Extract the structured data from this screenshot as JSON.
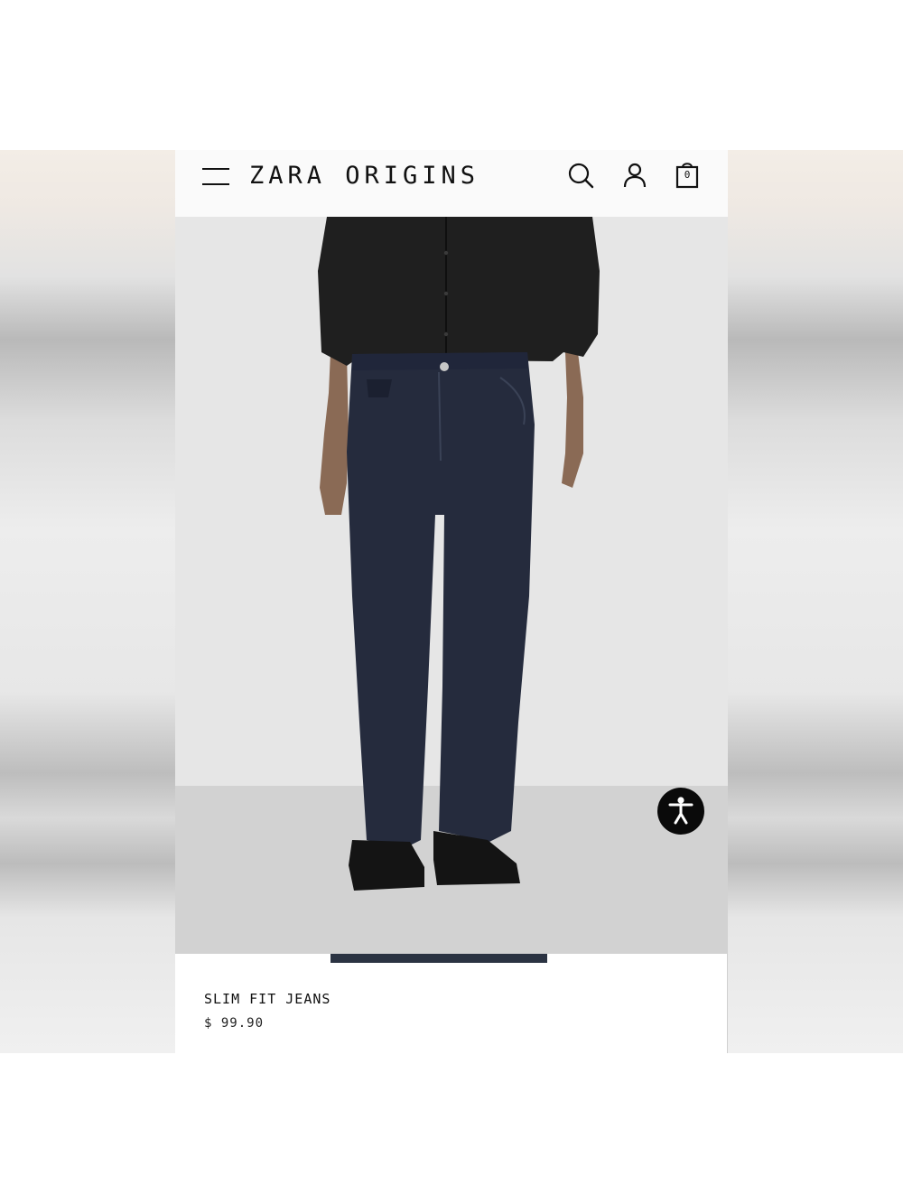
{
  "header": {
    "brand": "ZARA ORIGINS",
    "bag_count": "0",
    "icons": [
      "menu-icon",
      "search-icon",
      "account-icon",
      "bag-icon"
    ]
  },
  "product": {
    "name": "SLIM FIT JEANS",
    "price": "$ 99.90"
  },
  "colors": {
    "accent": "#111111",
    "denim": "#252b3d",
    "shirt": "#1d1d1d",
    "background": "#e6e6e6"
  },
  "floating": {
    "icon": "accessibility-icon"
  }
}
